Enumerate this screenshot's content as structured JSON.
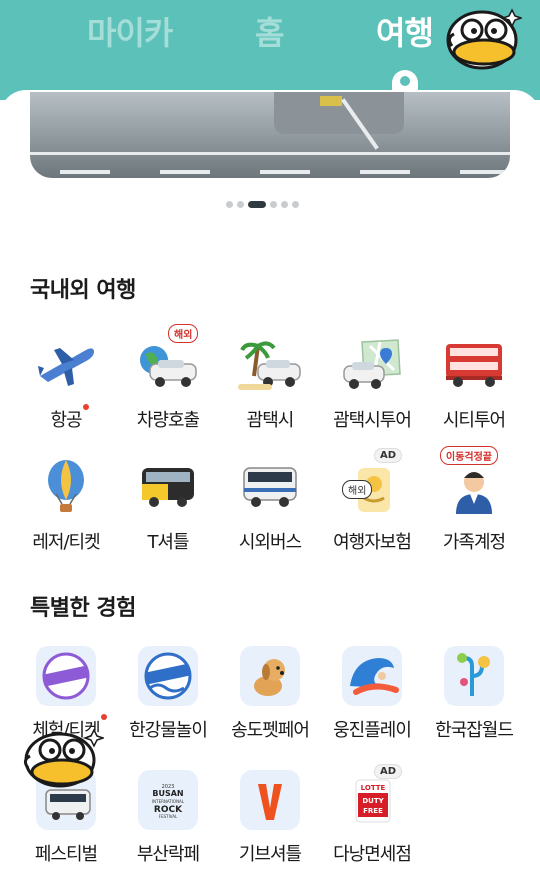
{
  "header": {
    "tabs": [
      {
        "label": "마이카",
        "active": false
      },
      {
        "label": "홈",
        "active": false
      },
      {
        "label": "여행",
        "active": true
      }
    ],
    "background_color": "#5cc1b9"
  },
  "banner": {
    "pagination_total": 6,
    "pagination_active": 3
  },
  "sections": [
    {
      "title": "국내외 여행",
      "items": [
        {
          "label": "항공",
          "icon": "airplane-icon",
          "new_dot": true
        },
        {
          "label": "차량호출",
          "icon": "car-globe-icon",
          "badge": "해외"
        },
        {
          "label": "괌택시",
          "icon": "palm-taxi-icon"
        },
        {
          "label": "괌택시투어",
          "icon": "map-taxi-icon"
        },
        {
          "label": "시티투어",
          "icon": "double-decker-bus-icon"
        },
        {
          "label": "레저/티켓",
          "icon": "hot-air-balloon-icon"
        },
        {
          "label": "T셔틀",
          "icon": "shuttle-bus-icon"
        },
        {
          "label": "시외버스",
          "icon": "intercity-bus-icon"
        },
        {
          "label": "여행자보험",
          "icon": "insurance-icon",
          "ad": "AD",
          "tag": "해외"
        },
        {
          "label": "가족계정",
          "icon": "family-account-icon",
          "badge": "이동걱정끝"
        }
      ]
    },
    {
      "title": "특별한 경험",
      "items": [
        {
          "label": "체험/티켓",
          "icon": "original-ticket-icon",
          "new_dot": true
        },
        {
          "label": "한강물놀이",
          "icon": "original-wave-icon"
        },
        {
          "label": "송도펫페어",
          "icon": "puppy-icon"
        },
        {
          "label": "웅진플레이",
          "icon": "surfing-icon"
        },
        {
          "label": "한국잡월드",
          "icon": "jobworld-icon"
        },
        {
          "label": "페스티벌",
          "icon": "festival-bus-icon"
        },
        {
          "label": "부산락페",
          "icon": "busan-rock-icon",
          "logo_text": [
            "2023",
            "BUSAN",
            "INTERNATIONAL",
            "ROCK",
            "FESTIVAL"
          ]
        },
        {
          "label": "기브셔틀",
          "icon": "give-shuttle-icon"
        },
        {
          "label": "다낭면세점",
          "icon": "lotte-duty-free-icon",
          "ad": "AD",
          "logo_text": [
            "LOTTE",
            "DUTY",
            "FREE"
          ]
        }
      ]
    }
  ],
  "colors": {
    "accent": "#5cc1b9",
    "notification": "#e8412f",
    "badge_red": "#d2322c"
  }
}
